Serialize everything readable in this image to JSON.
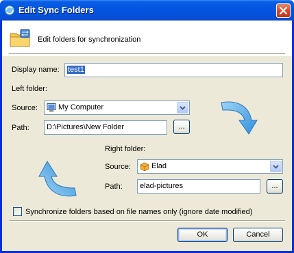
{
  "window": {
    "title": "Edit Sync Folders",
    "title_icon": "sync-globe-icon",
    "close_icon": "close-icon"
  },
  "header": {
    "text": "Edit folders for synchronization",
    "icon": "sync-folder-icon"
  },
  "display_name": {
    "label": "Display name:",
    "value": "test1"
  },
  "left_folder": {
    "heading": "Left folder:",
    "source_label": "Source:",
    "source_value": "My Computer",
    "source_icon": "my-computer-icon",
    "path_label": "Path:",
    "path_value": "D:\\Pictures\\New Folder",
    "browse_label": "..."
  },
  "right_folder": {
    "heading": "Right folder:",
    "source_label": "Source:",
    "source_value": "Elad",
    "source_icon": "box-icon",
    "path_label": "Path:",
    "path_value": "elad-pictures",
    "browse_label": "..."
  },
  "options": {
    "filenames_only_label": "Synchronize folders based on file names only (ignore date modified)",
    "filenames_only_checked": false
  },
  "buttons": {
    "ok": "OK",
    "cancel": "Cancel"
  },
  "colors": {
    "titlebar": "#0356e0",
    "dialog_bg": "#ece9d8",
    "arrow": "#5fb0e8",
    "selection": "#316ac5"
  }
}
